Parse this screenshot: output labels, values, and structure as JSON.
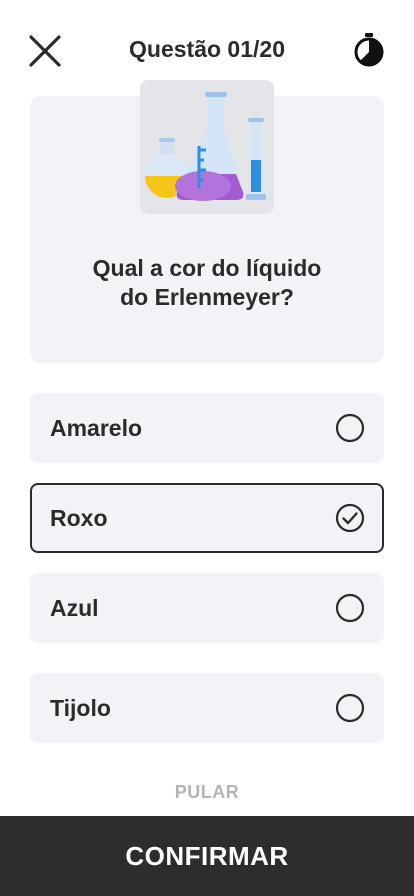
{
  "header": {
    "title": "Questão 01/20",
    "close_icon": "close-icon",
    "timer_icon": "timer-icon"
  },
  "question": {
    "illustration": "lab-flasks-illustration",
    "text_line1": "Qual a cor do líquido",
    "text_line2": "do Erlenmeyer?"
  },
  "options": [
    {
      "label": "Amarelo",
      "selected": false
    },
    {
      "label": "Roxo",
      "selected": true
    },
    {
      "label": "Azul",
      "selected": false
    },
    {
      "label": "Tijolo",
      "selected": false
    }
  ],
  "skip_label": "PULAR",
  "confirm_label": "CONFIRMAR",
  "colors": {
    "card_bg": "#f2f3f7",
    "text": "#2b2b2b",
    "confirm_bg": "#2d2d2d",
    "skip_text": "#b4b4b4",
    "liquid_purple": "#a45ad0",
    "liquid_yellow": "#f5c518",
    "liquid_blue": "#2f8de4"
  }
}
